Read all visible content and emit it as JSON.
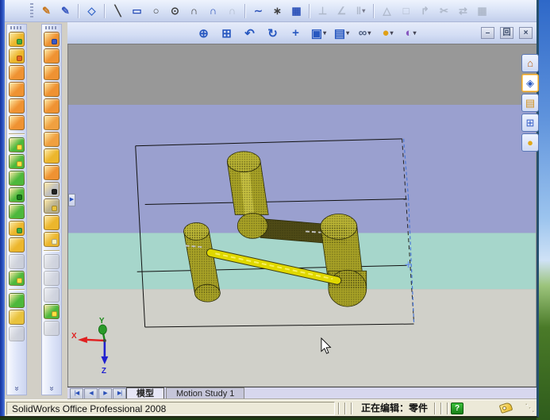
{
  "app": {
    "name": "SolidWorks"
  },
  "window": {
    "mdi_buttons": [
      {
        "name": "mdi-minimize",
        "glyph": "–"
      },
      {
        "name": "mdi-restore",
        "glyph": "回"
      },
      {
        "name": "mdi-close",
        "glyph": "×"
      }
    ]
  },
  "sketch_toolbar": {
    "items": [
      {
        "name": "sketch",
        "glyph": "✎",
        "color": "#c87820"
      },
      {
        "name": "3d-sketch",
        "glyph": "✎",
        "color": "#3858c0"
      },
      {
        "sep": true
      },
      {
        "name": "sketch-plane",
        "glyph": "◇",
        "color": "#3868c8"
      },
      {
        "sep": true
      },
      {
        "name": "line",
        "glyph": "╲",
        "color": "#404040"
      },
      {
        "name": "corner-rectangle",
        "glyph": "▭",
        "color": "#2a50b8"
      },
      {
        "name": "circle",
        "glyph": "○",
        "color": "#404040"
      },
      {
        "name": "perimeter-circle",
        "glyph": "⊙",
        "color": "#404040"
      },
      {
        "name": "centerpoint-arc",
        "glyph": "∩",
        "color": "#404040"
      },
      {
        "name": "tangent-arc",
        "glyph": "∩",
        "color": "#2a50b8"
      },
      {
        "name": "three-point-arc",
        "glyph": "∩",
        "color": "#404040",
        "disabled": true
      },
      {
        "sep": true
      },
      {
        "name": "spline",
        "glyph": "∼",
        "color": "#2a50b8"
      },
      {
        "name": "point",
        "glyph": "∗",
        "color": "#404040"
      },
      {
        "name": "linear-sketch-pattern",
        "glyph": "▦",
        "color": "#2a50b8"
      },
      {
        "sep": true
      },
      {
        "name": "add-relation",
        "glyph": "⊥",
        "color": "#404040",
        "disabled": true
      },
      {
        "name": "display-relations",
        "glyph": "∠",
        "color": "#404040",
        "disabled": true
      },
      {
        "name": "mirror-entities",
        "glyph": "‖",
        "color": "#404040",
        "disabled": true,
        "dropdown": true
      },
      {
        "sep": true
      },
      {
        "name": "check-sketch",
        "glyph": "△",
        "color": "#404040",
        "disabled": true
      },
      {
        "name": "rapid-sketch",
        "glyph": "□",
        "color": "#404040",
        "disabled": true
      },
      {
        "name": "convert-entities",
        "glyph": "↱",
        "color": "#404040",
        "disabled": true
      },
      {
        "name": "trim-entities",
        "glyph": "✂",
        "color": "#404040",
        "disabled": true
      },
      {
        "name": "move-entities",
        "glyph": "⇄",
        "color": "#404040",
        "disabled": true
      },
      {
        "name": "sketch-picture",
        "glyph": "▦",
        "color": "#404040",
        "disabled": true
      }
    ]
  },
  "view_toolbar": {
    "items": [
      {
        "name": "zoom-to-fit",
        "glyph": "⊕",
        "color": "#2858c0"
      },
      {
        "name": "zoom-to-area",
        "glyph": "⊞",
        "color": "#2858c0"
      },
      {
        "name": "previous-view",
        "glyph": "↶",
        "color": "#2858c0"
      },
      {
        "name": "rotate-view",
        "glyph": "↻",
        "color": "#2858c0"
      },
      {
        "name": "pan",
        "glyph": "+",
        "color": "#2858c0"
      },
      {
        "name": "view-orientation",
        "glyph": "▣",
        "color": "#2858c0",
        "dropdown": true
      },
      {
        "name": "display-style",
        "glyph": "▤",
        "color": "#2858c0",
        "dropdown": true
      },
      {
        "name": "hide-show-items",
        "glyph": "∞",
        "color": "#506080",
        "dropdown": true
      },
      {
        "name": "apply-scene",
        "glyph": "●",
        "color": "#e0a018",
        "dropdown": true
      },
      {
        "name": "edit-appearance",
        "glyph": "◐",
        "color": "#8858c0",
        "dropdown": true
      }
    ]
  },
  "features_toolbar": {
    "items": [
      {
        "name": "extruded-boss",
        "color": "#ecb62c",
        "accent": "#3fae3f"
      },
      {
        "name": "extruded-cut",
        "color": "#ecb62c",
        "accent": "#e86820"
      },
      {
        "name": "revolved-boss",
        "color": "#ef9232"
      },
      {
        "name": "swept-boss",
        "color": "#ef9232"
      },
      {
        "name": "lofted-boss",
        "color": "#ef9232"
      },
      {
        "name": "boundary-boss",
        "color": "#ef9232"
      },
      {
        "sep": true
      },
      {
        "name": "fillet",
        "color": "#4cb83c",
        "accent": "#ffe040"
      },
      {
        "name": "chamfer",
        "color": "#4cb83c",
        "accent": "#ffe040"
      },
      {
        "name": "rib",
        "color": "#4cb83c"
      },
      {
        "name": "shell",
        "color": "#4cb83c",
        "accent": "#1a7a1a"
      },
      {
        "name": "draft",
        "color": "#4cb83c"
      },
      {
        "name": "hole-wizard",
        "color": "#ecb62c",
        "accent": "#3fae3f"
      },
      {
        "name": "wrap",
        "color": "#ecb62c"
      },
      {
        "name": "linear-pattern",
        "color": "#c0c0c0",
        "disabled": true
      },
      {
        "name": "mirror",
        "color": "#4cb83c",
        "accent": "#ffe040"
      },
      {
        "sep": true
      },
      {
        "name": "dome",
        "color": "#4cb83c"
      },
      {
        "name": "flex",
        "color": "#e8c23c"
      },
      {
        "name": "deform",
        "color": "#c0c0c0",
        "disabled": true
      }
    ]
  },
  "surfaces_toolbar": {
    "items": [
      {
        "name": "extruded-surface",
        "color": "#ef9232",
        "accent": "#3858c8"
      },
      {
        "name": "revolved-surface",
        "color": "#ef9232"
      },
      {
        "name": "swept-surface",
        "color": "#ef9232"
      },
      {
        "name": "lofted-surface",
        "color": "#ef9232"
      },
      {
        "name": "boundary-surface",
        "color": "#ef9232"
      },
      {
        "name": "planar-surface",
        "color": "#f0a040"
      },
      {
        "name": "offset-surface",
        "color": "#f0a040"
      },
      {
        "name": "ruled-surface",
        "color": "#ecb62c"
      },
      {
        "name": "extend-surface",
        "color": "#ef9232"
      },
      {
        "name": "delete-face",
        "color": "#c0c0c0",
        "accent": "#222222"
      },
      {
        "name": "replace-face",
        "color": "#b8b090",
        "accent": "#e8c23c"
      },
      {
        "name": "knit-surface",
        "color": "#ecb62c"
      },
      {
        "name": "filled-surface",
        "color": "#ecb62c",
        "accent": "#f8f0c0"
      },
      {
        "sep": true
      },
      {
        "name": "untrim-surface",
        "color": "#c8c8c8",
        "disabled": true
      },
      {
        "name": "trim-surface",
        "color": "#c8c8c8",
        "disabled": true
      },
      {
        "name": "thicken",
        "color": "#c8c8c8",
        "disabled": true
      },
      {
        "name": "surface-fillet",
        "color": "#4cb83c",
        "accent": "#ffe040"
      },
      {
        "name": "cut-with-surface",
        "color": "#c8c8c8",
        "disabled": true
      }
    ]
  },
  "task_pane": {
    "tabs": [
      {
        "name": "solidworks-resources",
        "glyph": "⌂",
        "color": "#b85c10"
      },
      {
        "name": "design-library",
        "glyph": "◈",
        "color": "#2858c0",
        "active": true
      },
      {
        "name": "file-explorer",
        "glyph": "▤",
        "color": "#d09020"
      },
      {
        "name": "view-palette",
        "glyph": "⊞",
        "color": "#3860c8"
      },
      {
        "name": "appearances",
        "glyph": "●",
        "color": "#e0a818"
      }
    ]
  },
  "viewport": {
    "band_colors": {
      "sky": "#989898",
      "wall": "#9aa0cf",
      "mid": "#a6d6cb",
      "floor": "#d0d0c9"
    },
    "model_color": "#a8a226",
    "model_cap_color": "#b9b334",
    "rod_color": "#e0d800",
    "triad": {
      "x": "X",
      "y": "Y",
      "z": "Z"
    }
  },
  "bottom_tabs": {
    "nav": [
      {
        "name": "scroll-first",
        "glyph": "|◀"
      },
      {
        "name": "scroll-previous",
        "glyph": "◀"
      },
      {
        "name": "scroll-next",
        "glyph": "▶"
      },
      {
        "name": "scroll-last",
        "glyph": "▶|"
      }
    ],
    "tabs": [
      {
        "name": "tab-model",
        "label": "模型",
        "active": true
      },
      {
        "name": "tab-motion-study-1",
        "label": "Motion Study 1",
        "active": false
      }
    ]
  },
  "status_bar": {
    "product": "SolidWorks Office Professional 2008",
    "editing": "正在编辑：零件",
    "help_glyph": "?"
  }
}
